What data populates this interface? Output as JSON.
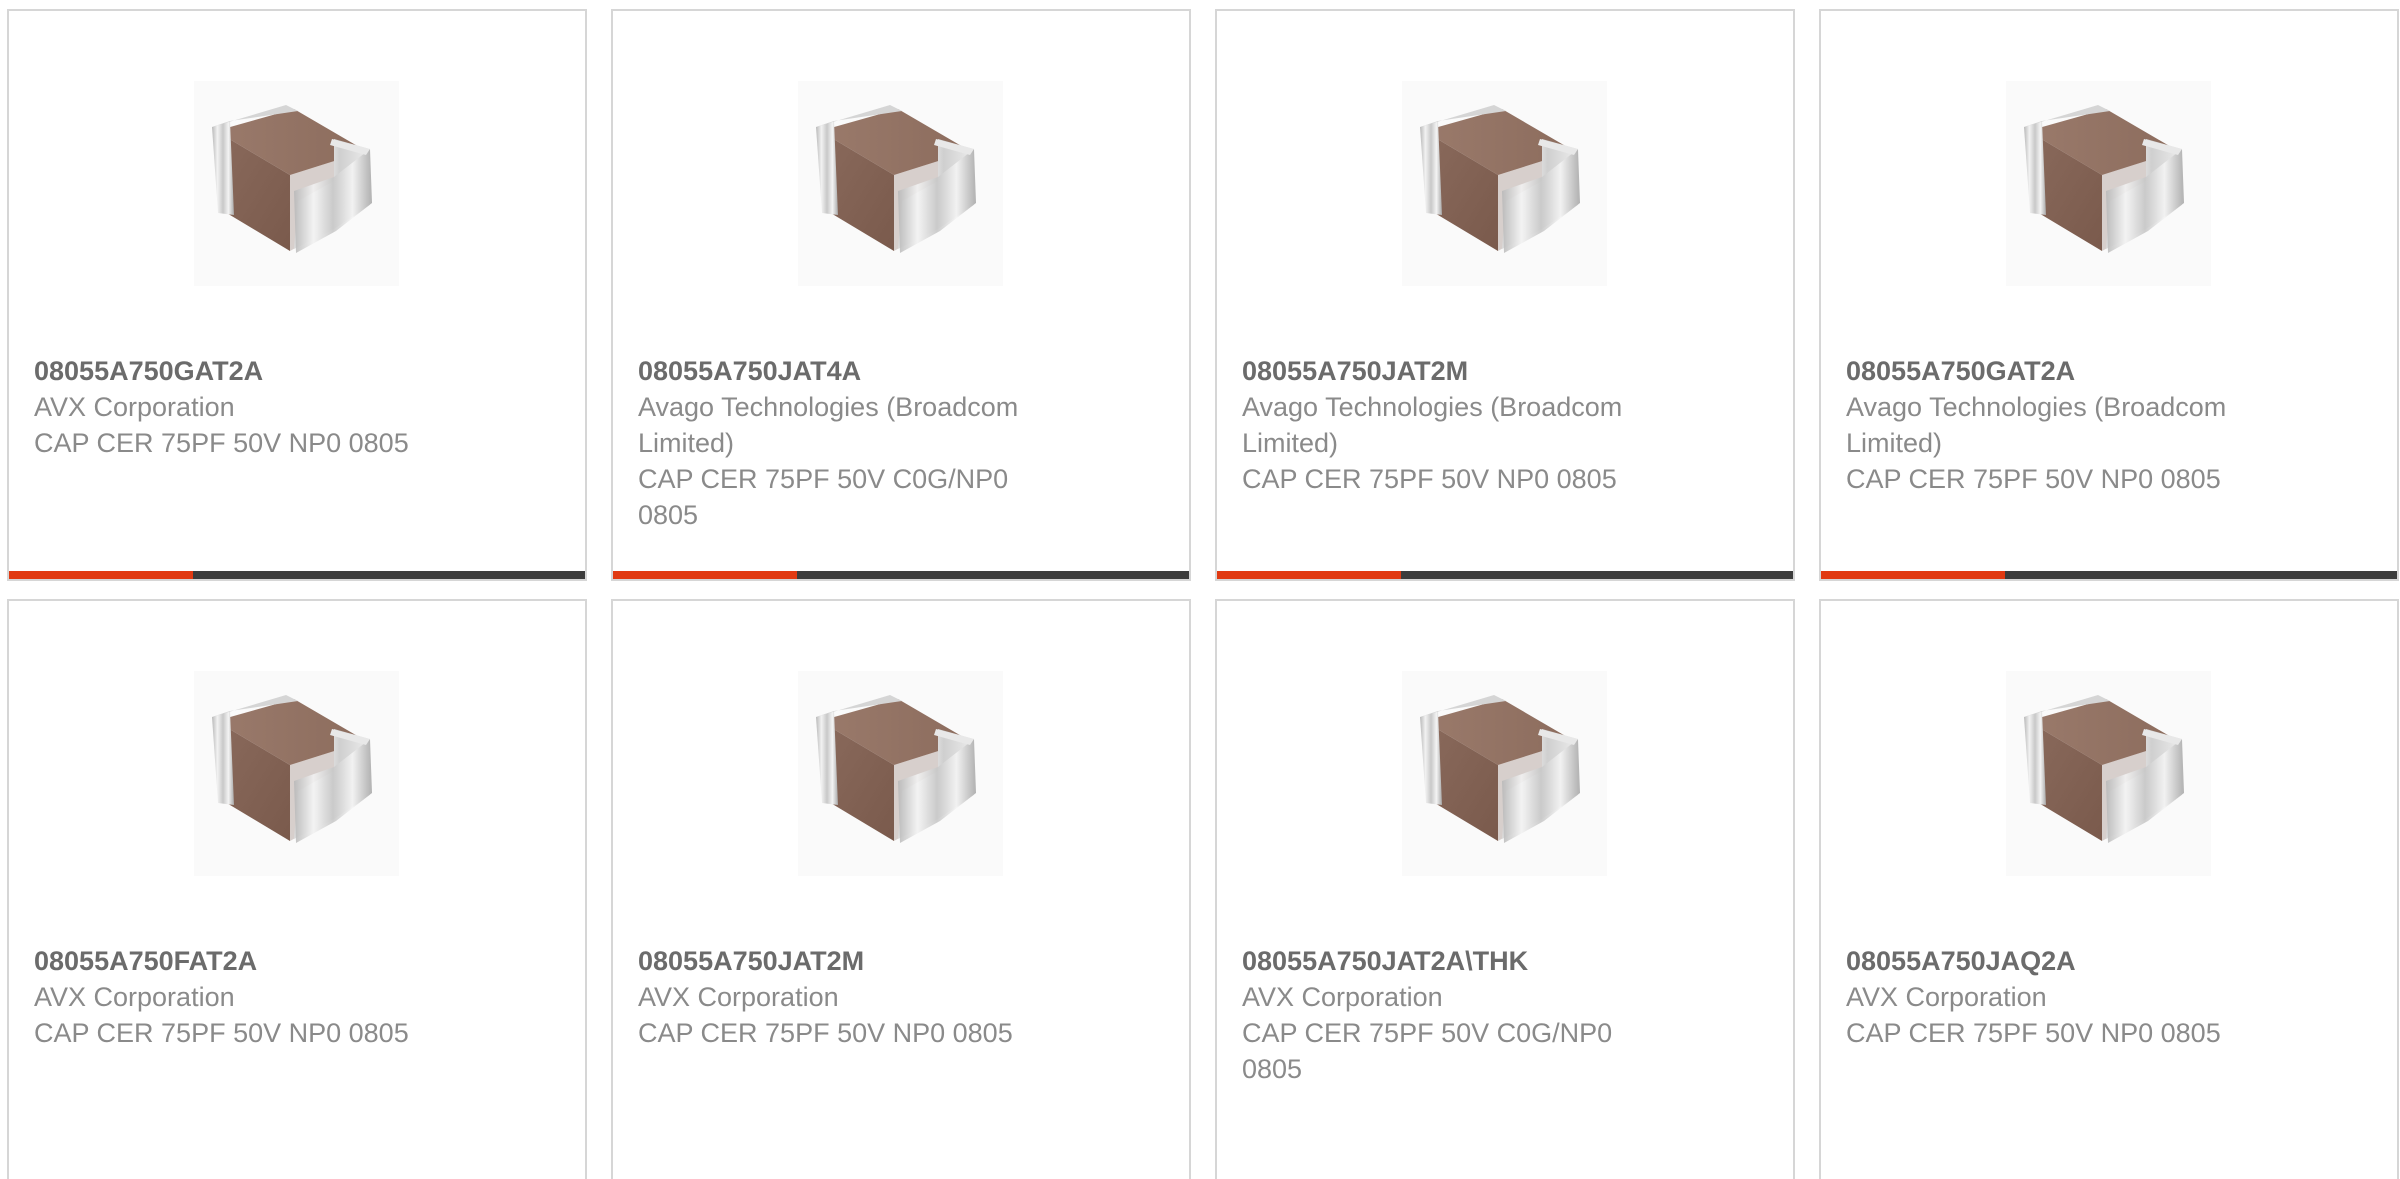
{
  "colors": {
    "accent": "#e13a12",
    "bar_dark": "#3c3c3c",
    "border": "#d6d6d6",
    "text_bold": "#6b6b6b",
    "text": "#8a8a8a"
  },
  "cards": [
    {
      "part_number": "08055A750GAT2A",
      "manufacturer": "AVX Corporation",
      "description": "CAP CER 75PF 50V NP0 0805",
      "image_icon": "ceramic-capacitor-chip-image",
      "progress": 0.32
    },
    {
      "part_number": "08055A750JAT4A",
      "manufacturer": "Avago Technologies (Broadcom Limited)",
      "description": "CAP CER 75PF 50V C0G/NP0 0805",
      "image_icon": "ceramic-capacitor-chip-image",
      "progress": 0.32
    },
    {
      "part_number": "08055A750JAT2M",
      "manufacturer": "Avago Technologies (Broadcom Limited)",
      "description": "CAP CER 75PF 50V NP0 0805",
      "image_icon": "ceramic-capacitor-chip-image",
      "progress": 0.32
    },
    {
      "part_number": "08055A750GAT2A",
      "manufacturer": "Avago Technologies (Broadcom Limited)",
      "description": "CAP CER 75PF 50V NP0 0805",
      "image_icon": "ceramic-capacitor-chip-image",
      "progress": 0.32
    },
    {
      "part_number": "08055A750FAT2A",
      "manufacturer": "AVX Corporation",
      "description": "CAP CER 75PF 50V NP0 0805",
      "image_icon": "ceramic-capacitor-chip-image"
    },
    {
      "part_number": "08055A750JAT2M",
      "manufacturer": "AVX Corporation",
      "description": "CAP CER 75PF 50V NP0 0805",
      "image_icon": "ceramic-capacitor-chip-image"
    },
    {
      "part_number": "08055A750JAT2A\\THK",
      "manufacturer": "AVX Corporation",
      "description": "CAP CER 75PF 50V C0G/NP0 0805",
      "image_icon": "ceramic-capacitor-chip-image"
    },
    {
      "part_number": "08055A750JAQ2A",
      "manufacturer": "AVX Corporation",
      "description": "CAP CER 75PF 50V NP0 0805",
      "image_icon": "ceramic-capacitor-chip-image"
    }
  ]
}
